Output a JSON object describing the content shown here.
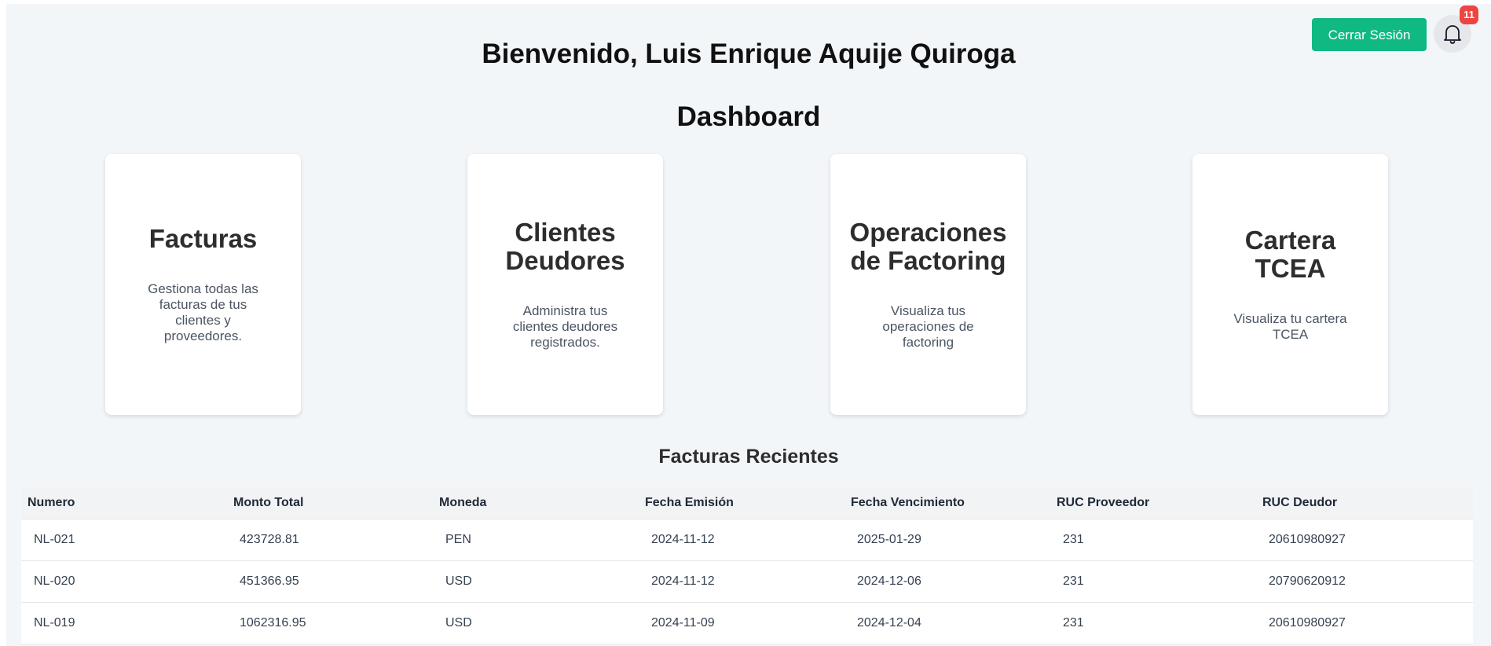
{
  "header": {
    "welcome": "Bienvenido, Luis Enrique Aquije Quiroga",
    "logout_label": "Cerrar Sesión",
    "notification_count": "11"
  },
  "dashboard": {
    "title": "Dashboard",
    "cards": [
      {
        "title": "Facturas",
        "description": "Gestiona todas las facturas de tus clientes y proveedores."
      },
      {
        "title": "Clientes Deudores",
        "description": "Administra tus clientes deudores registrados."
      },
      {
        "title": "Operaciones de Factoring",
        "description": "Visualiza tus operaciones de factoring"
      },
      {
        "title": "Cartera TCEA",
        "description": "Visualiza tu cartera TCEA"
      }
    ]
  },
  "recent": {
    "title": "Facturas Recientes",
    "columns": [
      "Numero",
      "Monto Total",
      "Moneda",
      "Fecha Emisión",
      "Fecha Vencimiento",
      "RUC Proveedor",
      "RUC Deudor"
    ],
    "rows": [
      [
        "NL-021",
        "423728.81",
        "PEN",
        "2024-11-12",
        "2025-01-29",
        "231",
        "20610980927"
      ],
      [
        "NL-020",
        "451366.95",
        "USD",
        "2024-11-12",
        "2024-12-06",
        "231",
        "20790620912"
      ],
      [
        "NL-019",
        "1062316.95",
        "USD",
        "2024-11-09",
        "2024-12-04",
        "231",
        "20610980927"
      ]
    ]
  },
  "colors": {
    "accent": "#10b981",
    "badge": "#ef4444",
    "background": "#f3f6f9"
  },
  "icons": {
    "notifications": "bell-icon"
  }
}
